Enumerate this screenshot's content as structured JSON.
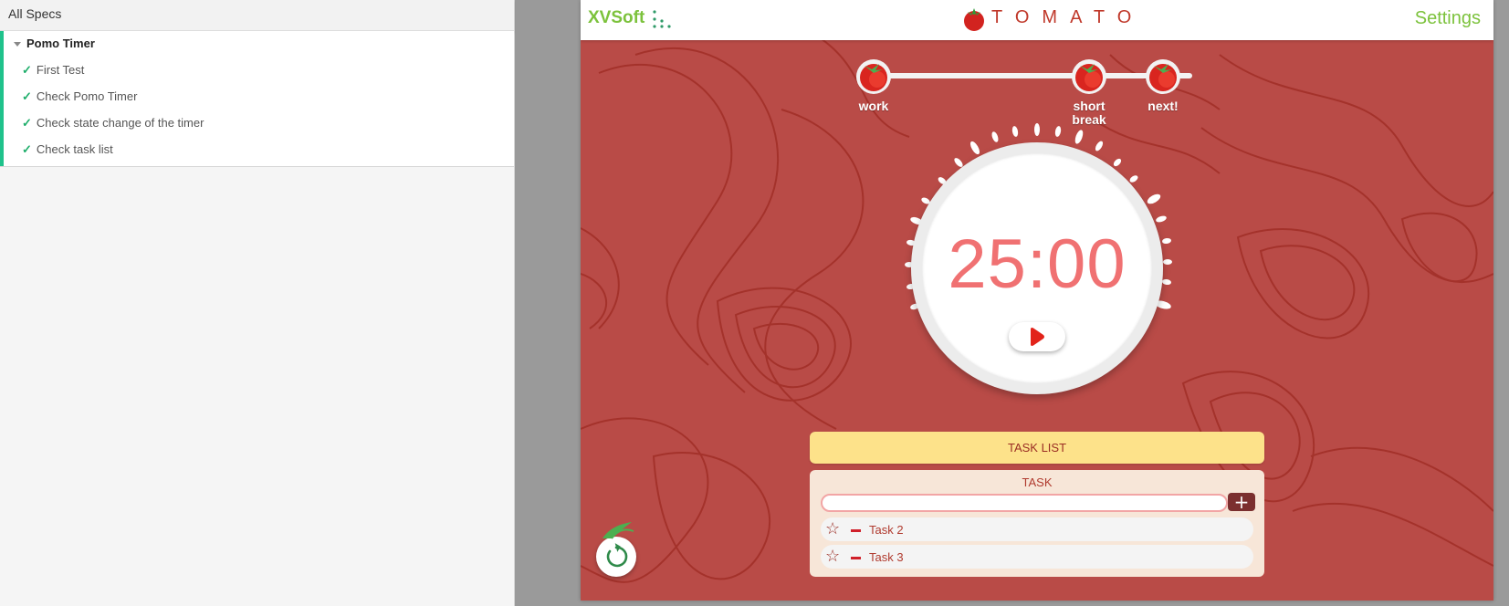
{
  "spec_panel": {
    "header": "All Specs",
    "suite": {
      "title": "Pomo Timer",
      "tests": [
        {
          "label": "First Test",
          "status": "passed"
        },
        {
          "label": "Check Pomo Timer",
          "status": "passed"
        },
        {
          "label": "Check state change of the timer",
          "status": "passed"
        },
        {
          "label": "Check task list",
          "status": "passed"
        }
      ]
    }
  },
  "app": {
    "brand": "XVSoft",
    "title": "TOMATO",
    "settings_label": "Settings",
    "stages": [
      {
        "label": "work"
      },
      {
        "label": "short break"
      },
      {
        "label": "next!"
      }
    ],
    "timer": {
      "display": "25:00"
    },
    "task_list": {
      "header": "TASK LIST",
      "task_heading": "TASK",
      "input_value": "",
      "add_icon": "plus-icon",
      "tasks": [
        {
          "label": "Task 2"
        },
        {
          "label": "Task 3"
        }
      ]
    }
  },
  "colors": {
    "brand_green": "#7cc23c",
    "background_red": "#b94b47",
    "timer_text": "#f07172",
    "task_header_yellow": "#fde28a",
    "spec_pass_green": "#1fc28b"
  }
}
